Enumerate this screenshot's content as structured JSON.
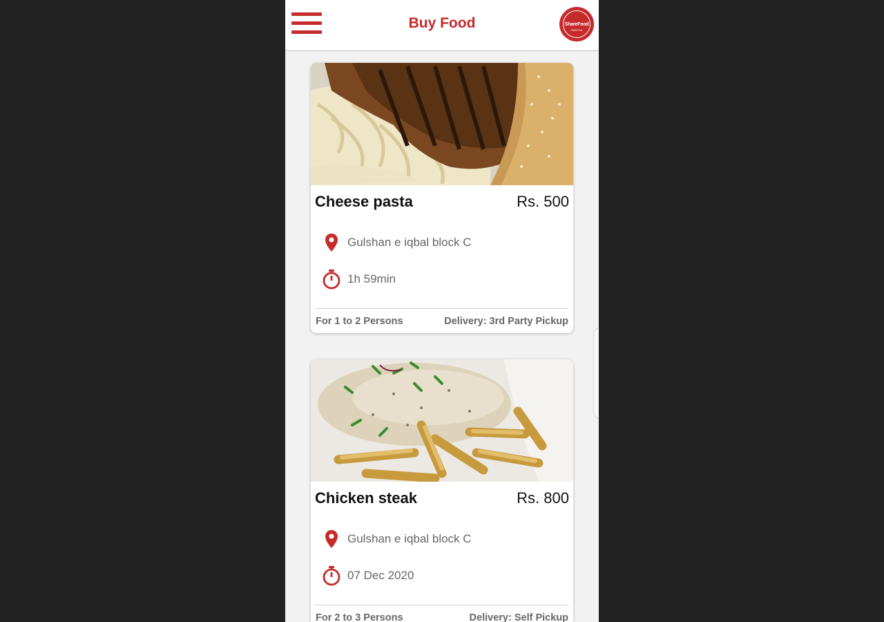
{
  "header": {
    "title": "Buy Food",
    "logo_text": "ShareFood",
    "logo_subtext": "PAKISTAN"
  },
  "colors": {
    "accent": "#c62a2a",
    "background": "#f2f2f2",
    "card": "#ffffff",
    "muted_text": "#666666"
  },
  "listings": [
    {
      "name": "Cheese pasta",
      "price": "Rs. 500",
      "location": "Gulshan e iqbal block C",
      "location_icon": "map-pin-icon",
      "time": "1h 59min",
      "time_icon": "stopwatch-icon",
      "serving": "For 1 to 2 Persons",
      "delivery": "Delivery: 3rd Party Pickup"
    },
    {
      "name": "Chicken steak",
      "price": "Rs. 800",
      "location": "Gulshan e iqbal block C",
      "location_icon": "map-pin-icon",
      "time": "07 Dec 2020",
      "time_icon": "stopwatch-icon",
      "serving": "For 2 to 3 Persons",
      "delivery": "Delivery: Self Pickup"
    }
  ]
}
